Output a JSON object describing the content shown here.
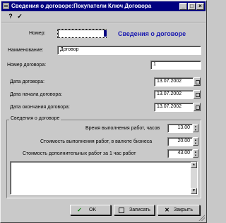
{
  "window": {
    "title": "Сведения о договоре:Покупатели Ключ Договора",
    "min_glyph": "_",
    "max_glyph": "□",
    "close_glyph": "×"
  },
  "toolbar": {
    "help_glyph": "?",
    "check_glyph": "✓"
  },
  "heading": "Сведения о договоре",
  "fields": {
    "number": {
      "label": "Номер:",
      "value": ""
    },
    "name": {
      "label": "Наименование:",
      "value": "Договор"
    },
    "contract_no": {
      "label": "Номер договора:",
      "value": "1"
    },
    "contract_date": {
      "label": "Дата договора:",
      "value": "13.07.2002"
    },
    "start_date": {
      "label": "Дата начала договора:",
      "value": "13.07.2002"
    },
    "end_date": {
      "label": "Дата окончания договора:",
      "value": "13.07.2002"
    }
  },
  "group": {
    "title": "Сведения о договоре",
    "hours": {
      "label": "Время выполнения работ, часов",
      "value": "13.00"
    },
    "cost": {
      "label": "Стоимость выполнения работ, в валюте бизнеса",
      "value": "20.00"
    },
    "extra": {
      "label": "Стоимость дополнительных работ за 1 час работ",
      "value": "43.00"
    }
  },
  "buttons": {
    "ok": "OK",
    "save": "Записать",
    "close": "Закрыть"
  }
}
